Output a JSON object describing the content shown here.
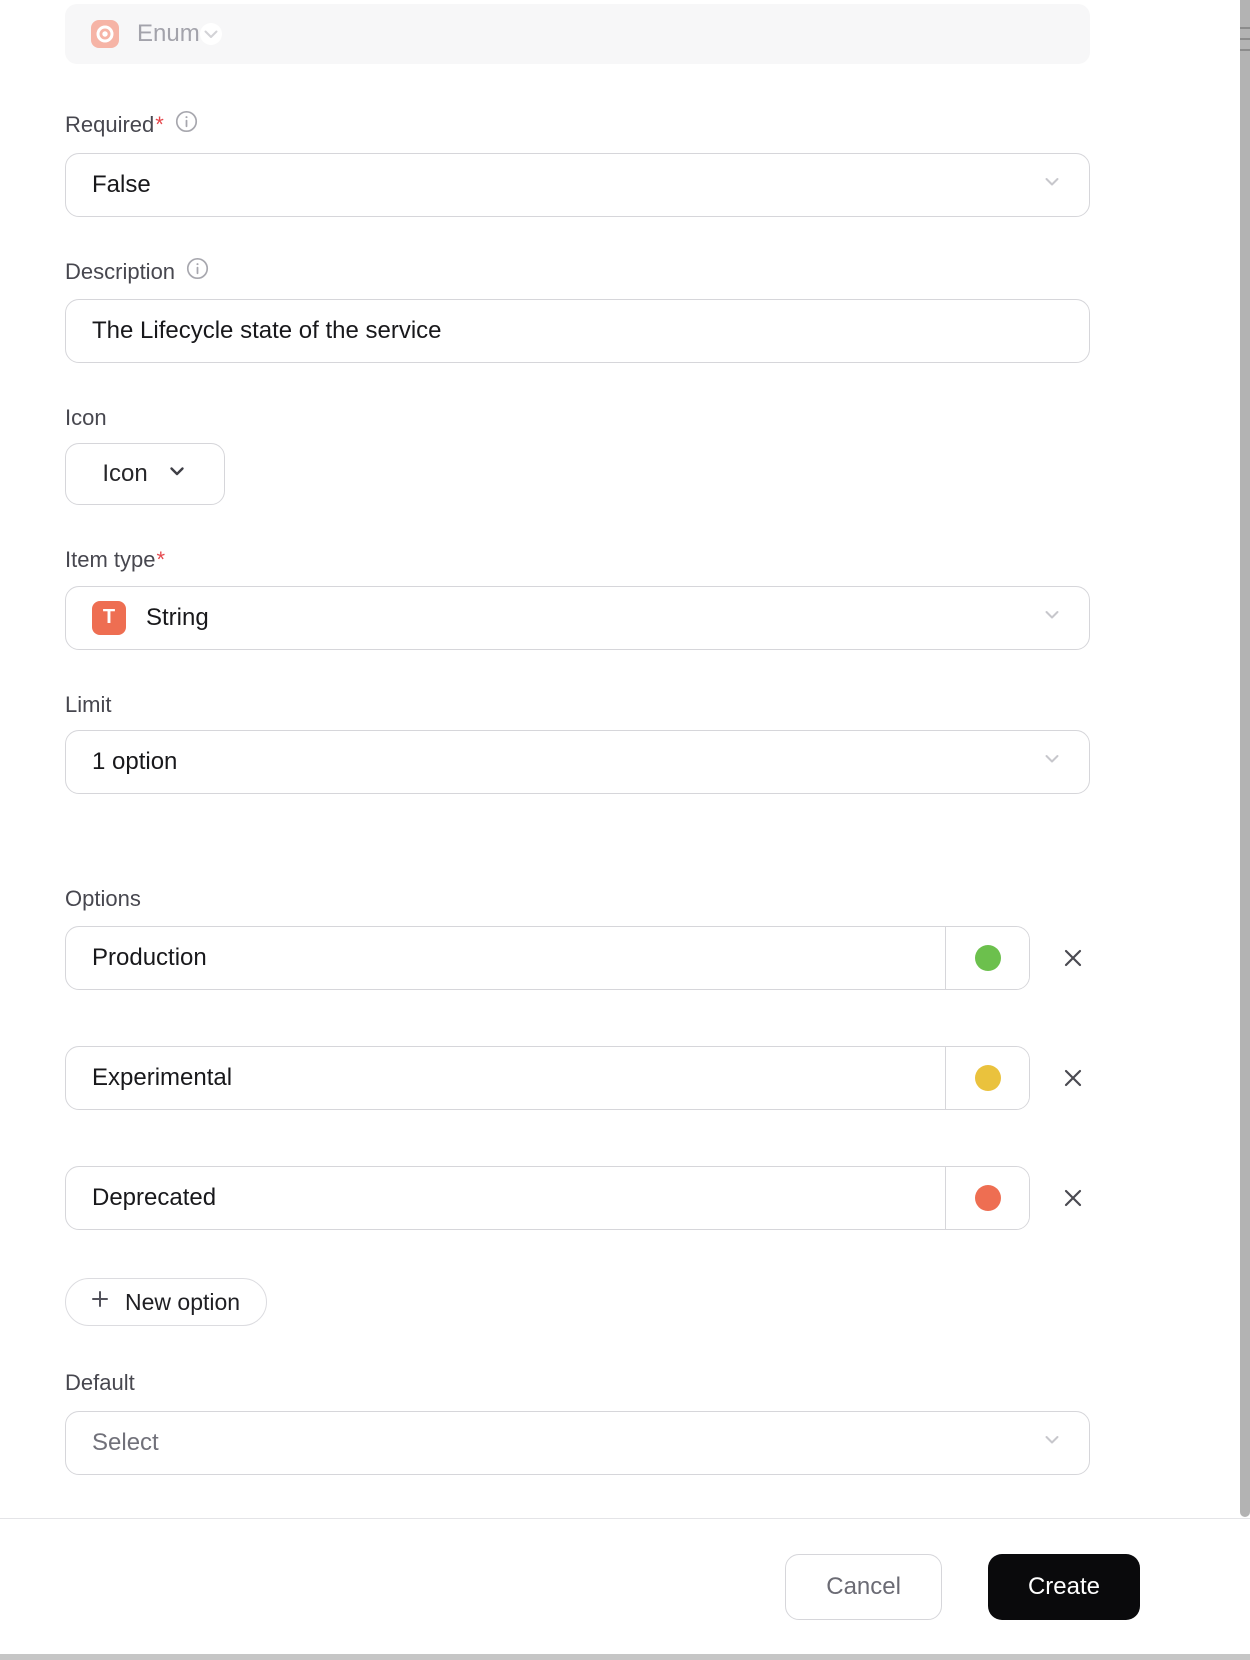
{
  "dialog": {
    "type_selector": {
      "value": "Enum"
    },
    "required": {
      "label": "Required",
      "mark": "*",
      "value": "False"
    },
    "description": {
      "label": "Description",
      "value": "The Lifecycle state of the service"
    },
    "icon": {
      "label": "Icon",
      "button": "Icon"
    },
    "item_type": {
      "label": "Item type",
      "mark": "*",
      "badge": "T",
      "value": "String"
    },
    "limit": {
      "label": "Limit",
      "value": "1 option"
    },
    "options": {
      "label": "Options",
      "items": [
        {
          "value": "Production",
          "color": "#6cc04d"
        },
        {
          "value": "Experimental",
          "color": "#eac23d"
        },
        {
          "value": "Deprecated",
          "color": "#ee6e52"
        }
      ],
      "new_option": "New option"
    },
    "default": {
      "label": "Default",
      "placeholder": "Select"
    },
    "footer": {
      "cancel": "Cancel",
      "create": "Create"
    }
  }
}
